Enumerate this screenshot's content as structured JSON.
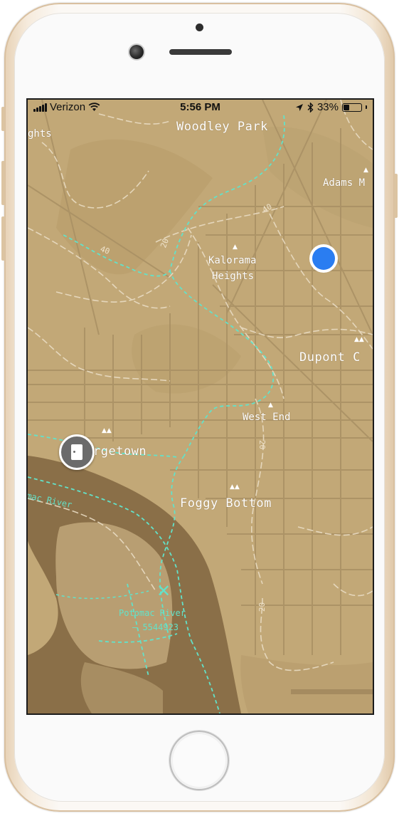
{
  "status_bar": {
    "carrier": "Verizon",
    "time": "5:56 PM",
    "battery": "33%",
    "battery_level": 0.33,
    "icons": [
      "signal-icon",
      "wifi-icon",
      "location-arrow-icon",
      "bluetooth-icon",
      "battery-icon"
    ]
  },
  "map": {
    "labels": {
      "woodley_park": "Woodley Park",
      "heights_partial": "ghts",
      "adams_partial": "Adams M",
      "kalorama_line1": "Kalorama",
      "kalorama_line2": "Heights",
      "dupont_partial": "Dupont C",
      "west_end": "West End",
      "georgetown_partial": "rgetown",
      "river_partial": "mac River",
      "foggy_bottom": "Foggy Bottom",
      "potomac_line1": "Potomac River",
      "potomac_line2": "— 5544923"
    },
    "contour_labels": {
      "c40_top": "40",
      "c40_left": "40",
      "c20_left": "20",
      "c20_mid": "20",
      "c20_low": "20"
    },
    "colors": {
      "land": "#c2a877",
      "water": "#8a6f48",
      "streets": "#a99064",
      "contours": "#e9dcc3",
      "waterways": "#62e2c9",
      "user_location": "#2a7df1",
      "pin": "#6b6b6b"
    },
    "markers": [
      "user-location-dot",
      "pin-marker-door-icon",
      "x-marker-icon"
    ]
  }
}
